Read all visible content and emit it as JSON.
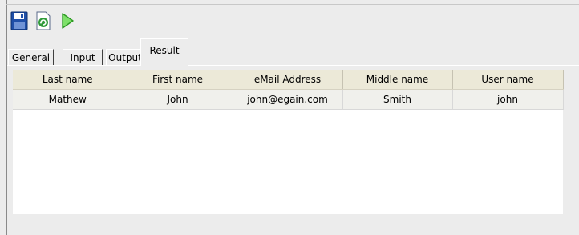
{
  "toolbar": {
    "buttons": [
      {
        "name": "save-button",
        "icon": "floppy-disk-icon"
      },
      {
        "name": "refresh-button",
        "icon": "refresh-icon"
      },
      {
        "name": "run-button",
        "icon": "play-icon"
      }
    ]
  },
  "tabs": [
    "General",
    "Input",
    "Output",
    "Result"
  ],
  "active_tab": "Result",
  "table": {
    "columns": [
      "Last name",
      "First name",
      "eMail Address",
      "Middle name",
      "User name"
    ],
    "rows": [
      [
        "Mathew",
        "John",
        "john@egain.com",
        "Smith",
        "john"
      ]
    ]
  },
  "colors": {
    "save_icon": "#1f4fa8",
    "refresh_icon": "#2f9a3a",
    "play_icon": "#3cbf2e",
    "header_bg": "#ece9d8",
    "row_bg": "#f0f0ec"
  }
}
